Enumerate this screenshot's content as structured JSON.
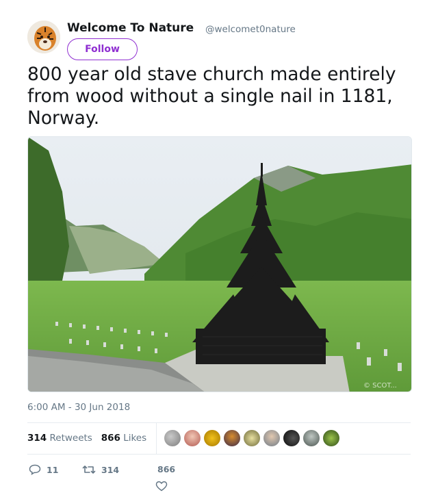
{
  "user": {
    "name": "Welcome To Nature",
    "handle": "@welcomet0nature",
    "follow_label": "Follow"
  },
  "tweet": {
    "text": "800 year old stave church made entirely from wood without a single nail in 1181, Norway.",
    "timestamp": "6:00 AM - 30 Jun 2018"
  },
  "stats": {
    "retweets_count": "314",
    "retweets_label": "Retweets",
    "likes_count": "866",
    "likes_label": "Likes"
  },
  "actions": {
    "reply_count": "11",
    "retweet_count": "314",
    "like_count": "866"
  },
  "photo": {
    "watermark": "© SCOT..."
  },
  "colors": {
    "accent": "#8f2ed1",
    "muted": "#657786",
    "text": "#14171a"
  }
}
